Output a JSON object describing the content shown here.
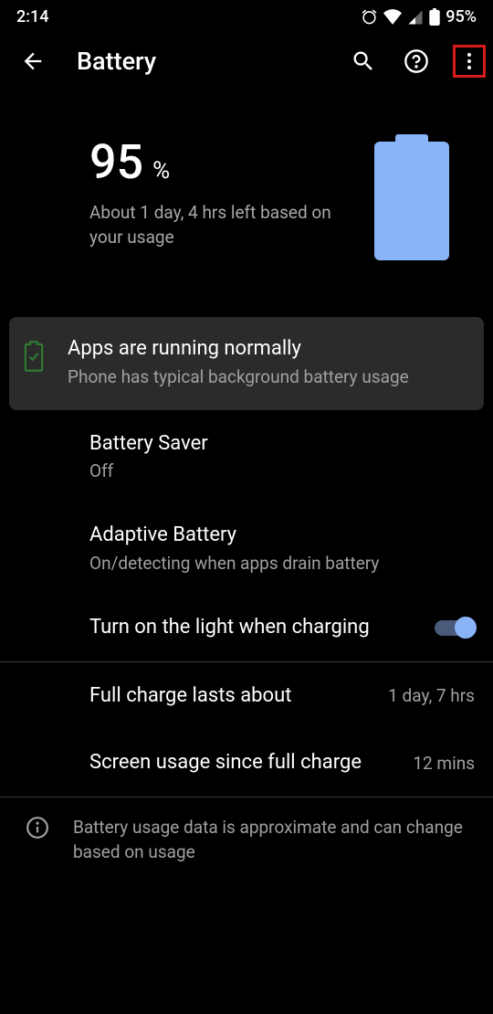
{
  "status_bar": {
    "time": "2:14",
    "battery_pct": "95%"
  },
  "app_bar": {
    "title": "Battery"
  },
  "hero": {
    "percent": "95",
    "percent_symbol": "%",
    "subtitle": "About 1 day, 4 hrs left based on your usage"
  },
  "status_card": {
    "title": "Apps are running normally",
    "subtitle": "Phone has typical background battery usage"
  },
  "settings": {
    "battery_saver": {
      "title": "Battery Saver",
      "subtitle": "Off"
    },
    "adaptive": {
      "title": "Adaptive Battery",
      "subtitle": "On/detecting when apps drain battery"
    },
    "light_charging": {
      "title": "Turn on the light when charging",
      "enabled": true
    },
    "full_charge": {
      "title": "Full charge lasts about",
      "value": "1 day, 7 hrs"
    },
    "screen_usage": {
      "title": "Screen usage since full charge",
      "value": "12 mins"
    }
  },
  "footer": {
    "text": "Battery usage data is approximate and can change based on usage"
  }
}
